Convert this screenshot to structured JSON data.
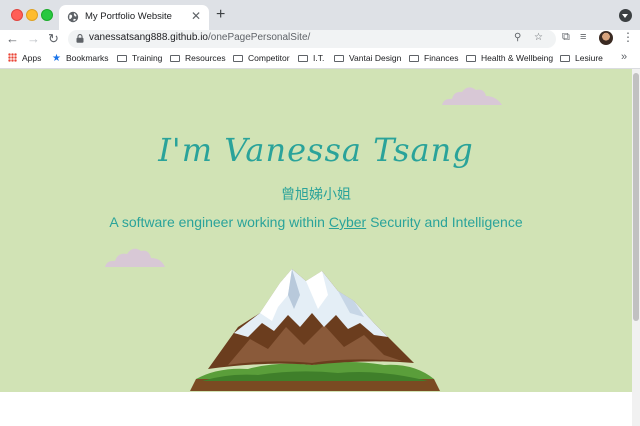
{
  "browser": {
    "tab": {
      "title": "My Portfolio Website"
    },
    "url": {
      "host": "vanessatsang888.github.io",
      "path": "/onePagePersonalSite/"
    },
    "bookmarks": [
      {
        "label": "Apps",
        "icon": "apps-grid-icon"
      },
      {
        "label": "Bookmarks",
        "icon": "star-icon"
      },
      {
        "label": "Training",
        "icon": "folder-icon"
      },
      {
        "label": "Resources",
        "icon": "folder-icon"
      },
      {
        "label": "Competitor",
        "icon": "folder-icon"
      },
      {
        "label": "I.T.",
        "icon": "folder-icon"
      },
      {
        "label": "Vantai Design",
        "icon": "folder-icon"
      },
      {
        "label": "Finances",
        "icon": "folder-icon"
      },
      {
        "label": "Health & Wellbeing",
        "icon": "folder-icon"
      },
      {
        "label": "Lesiure",
        "icon": "folder-icon"
      }
    ],
    "more_label": "»"
  },
  "hero": {
    "name": "I'm Vanessa Tsang",
    "chinese_name": "曾旭娣小姐",
    "tagline_before": "A software engineer working within ",
    "tagline_link": "Cyber",
    "tagline_after": " Security and Intelligence"
  },
  "colors": {
    "hero_background": "#d1e3b5",
    "accent_text": "#2aa39a",
    "cloud": "#d8c8d6"
  }
}
